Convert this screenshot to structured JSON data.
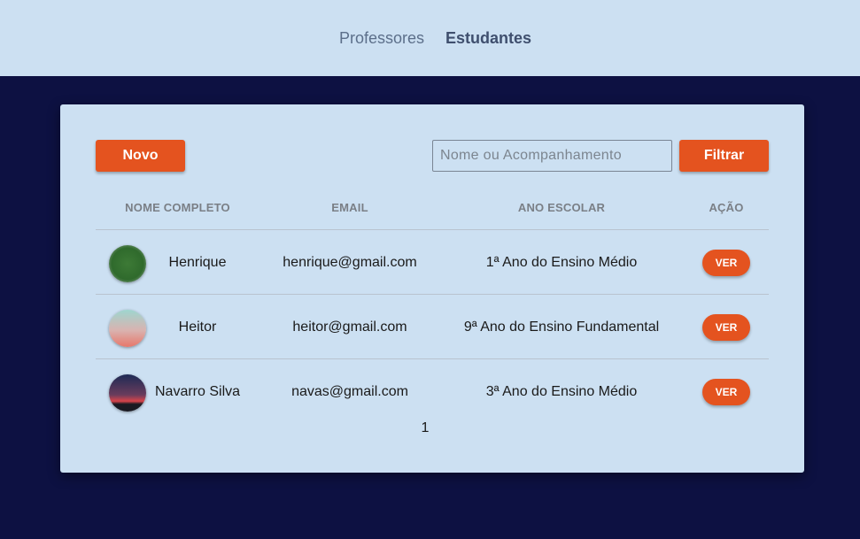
{
  "nav": {
    "professores": "Professores",
    "estudantes": "Estudantes"
  },
  "toolbar": {
    "novo_label": "Novo",
    "search_placeholder": "Nome ou Acompanhamento",
    "search_value": "",
    "filtrar_label": "Filtrar"
  },
  "table": {
    "headers": [
      "NOME COMPLETO",
      "EMAIL",
      "ANO ESCOLAR",
      "AÇÃO"
    ],
    "rows": [
      {
        "nome": "Henrique",
        "email": "henrique@gmail.com",
        "ano": "1ª Ano do Ensino Médio",
        "acao": "VER"
      },
      {
        "nome": "Heitor",
        "email": "heitor@gmail.com",
        "ano": "9ª Ano do Ensino Fundamental",
        "acao": "VER"
      },
      {
        "nome": "Navarro Silva",
        "email": "navas@gmail.com",
        "ano": "3ª Ano do Ensino Médio",
        "acao": "VER"
      }
    ]
  },
  "pagination": {
    "current": "1"
  },
  "colors": {
    "accent": "#e4531f",
    "background": "#0d1142",
    "surface": "#cce0f2"
  }
}
